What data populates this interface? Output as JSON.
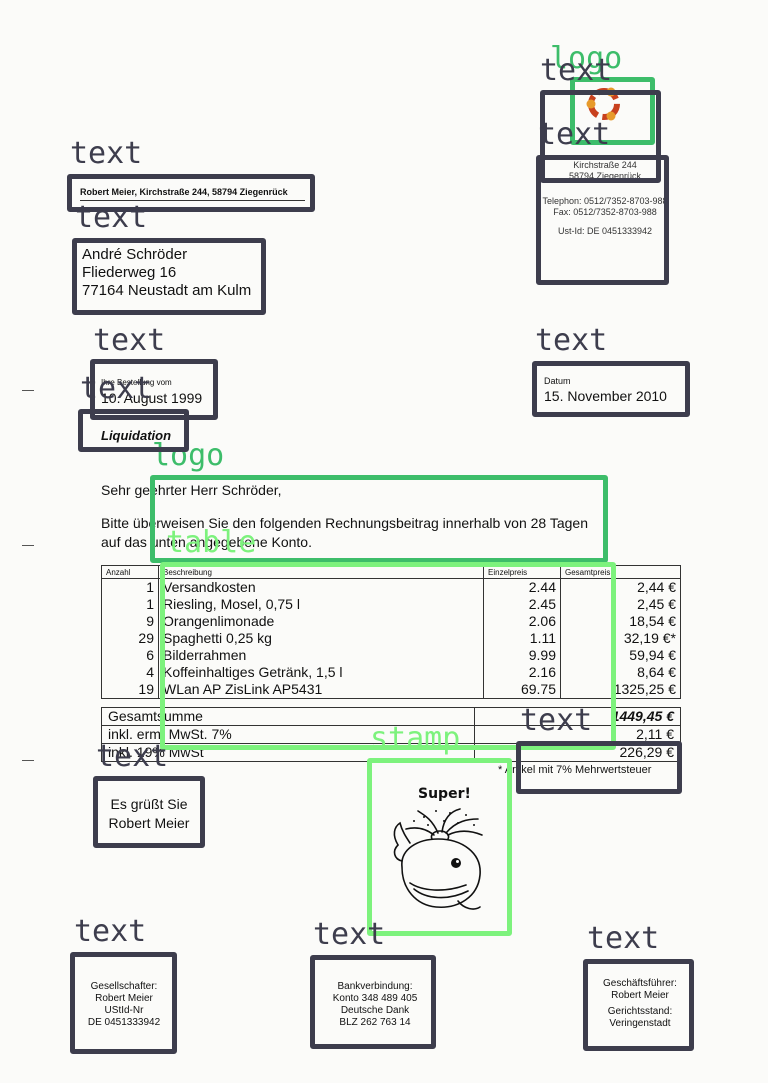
{
  "tags": {
    "text": "text",
    "logo": "logo",
    "table": "table",
    "stamp": "stamp"
  },
  "sender": {
    "return_line": "Robert Meier, Kirchstraße 244, 58794 Ziegenrück"
  },
  "recipient": {
    "name": "André Schröder",
    "street": "Fliederweg 16",
    "city": "77164 Neustadt am Kulm"
  },
  "company": {
    "street": "Kirchstraße 244",
    "city": "58794 Ziegenrück",
    "phone": "Telephon:  0512/7352-8703-988",
    "fax": "Fax:  0512/7352-8703-988",
    "ust": "Ust-Id: DE 0451333942"
  },
  "order": {
    "label": "Ihre Bestellung vom",
    "date": "10. August 1999"
  },
  "doc_date": {
    "label": "Datum",
    "value": "15. November 2010"
  },
  "doc_type": "Liquidation",
  "letter": {
    "salutation": "Sehr geehrter Herr Schröder,",
    "body_line1": "Bitte überweisen Sie den folgenden Rechnungsbeitrag innerhalb von 28 Tagen",
    "body_line2": "auf das unten angegebene Konto."
  },
  "table": {
    "headers": [
      "Anzahl",
      "Beschreibung",
      "Einzelpreis",
      "Gesamtpreis"
    ],
    "rows": [
      {
        "qty": "1",
        "desc": "Versandkosten",
        "unit": "2.44",
        "total": "2,44 €"
      },
      {
        "qty": "1",
        "desc": "Riesling, Mosel, 0,75 l",
        "unit": "2.45",
        "total": "2,45 €"
      },
      {
        "qty": "9",
        "desc": "Orangenlimonade",
        "unit": "2.06",
        "total": "18,54 €"
      },
      {
        "qty": "29",
        "desc": "Spaghetti 0,25 kg",
        "unit": "1.11",
        "total": "32,19 €*"
      },
      {
        "qty": "6",
        "desc": "Bilderrahmen",
        "unit": "9.99",
        "total": "59,94 €"
      },
      {
        "qty": "4",
        "desc": "Koffeinhaltiges Getränk, 1,5 l",
        "unit": "2.16",
        "total": "8,64 €"
      },
      {
        "qty": "19",
        "desc": "WLan AP ZisLink AP5431",
        "unit": "69.75",
        "total": "1325,25 €"
      }
    ],
    "totals": [
      {
        "label": "Gesamtsumme",
        "value": "1449,45 €"
      },
      {
        "label": "inkl. erm. MwSt. 7%",
        "value": "2,11 €"
      },
      {
        "label": "inkl. 19% MwSt",
        "value": "226,29 €"
      }
    ],
    "footnote": "* Artikel mit 7% Mehrwertsteuer"
  },
  "stamp_text": "Super!",
  "closing": {
    "line1": "Es grüßt Sie",
    "line2": "Robert Meier"
  },
  "footer": {
    "partners": [
      "Gesellschafter:",
      "Robert Meier",
      "UStId-Nr",
      "DE 0451333942"
    ],
    "bank": [
      "Bankverbindung:",
      "Konto 348 489 405",
      "Deutsche Dank",
      "BLZ 262 763 14"
    ],
    "management": [
      "Geschäftsführer:",
      "Robert Meier",
      "Gerichtsstand:",
      "Veringenstadt"
    ]
  }
}
